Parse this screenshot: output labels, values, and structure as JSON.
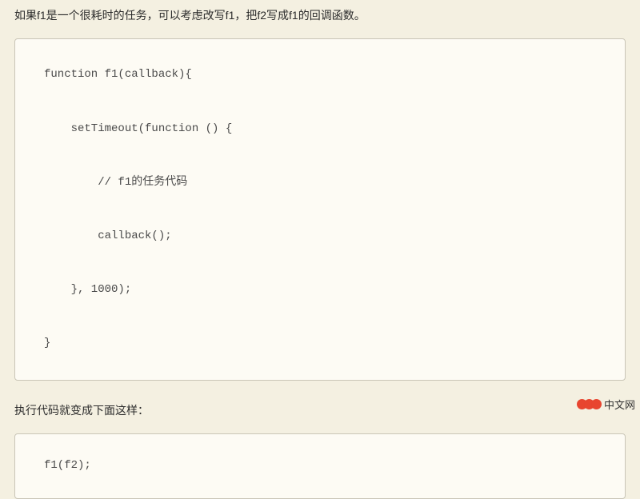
{
  "paragraph1": "如果f1是一个很耗时的任务，可以考虑改写f1，把f2写成f1的回调函数。",
  "code1": "function f1(callback){\n\n    setTimeout(function () {\n\n        // f1的任务代码\n\n        callback();\n\n    }, 1000);\n\n}",
  "paragraph2": "执行代码就变成下面这样：",
  "code2": "f1(f2);",
  "watermark": "中文网"
}
